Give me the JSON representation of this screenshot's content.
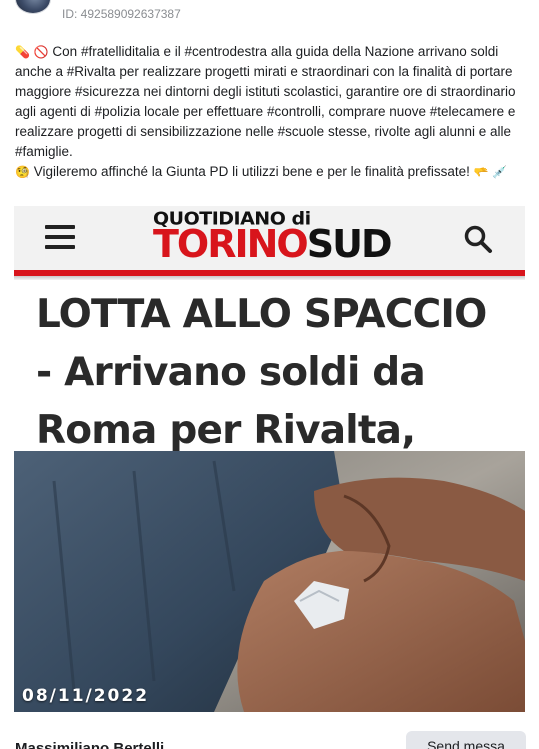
{
  "post": {
    "id_text": "ID: 492589092637387",
    "body": {
      "line1": [
        {
          "t": "💊",
          "k": "emoji-pill"
        },
        {
          "t": " "
        },
        {
          "t": "🚫",
          "k": "emoji-ban"
        },
        {
          "t": " Con "
        },
        {
          "t": "#fratelliditalia",
          "k": "hash"
        },
        {
          "t": " e il "
        },
        {
          "t": "#centrodestra",
          "k": "hash"
        },
        {
          "t": " alla guida della Nazione arrivano soldi anche a "
        },
        {
          "t": "#Rivalta",
          "k": "hash"
        },
        {
          "t": " per realizzare progetti mirati e straordinari con la finalità di portare maggiore "
        },
        {
          "t": "#sicurezza",
          "k": "hash"
        },
        {
          "t": " nei dintorni degli istituti scolastici, garantire ore di straordinario agli agenti di "
        },
        {
          "t": "#polizia",
          "k": "hash"
        },
        {
          "t": " locale per effettuare "
        },
        {
          "t": "#controlli",
          "k": "hash"
        },
        {
          "t": ", comprare nuove "
        },
        {
          "t": "#telecamere",
          "k": "hash"
        },
        {
          "t": " e realizzare progetti di sensibilizzazione nelle "
        },
        {
          "t": "#scuole",
          "k": "hash"
        },
        {
          "t": " stesse, rivolte agli alunni e alle "
        },
        {
          "t": "#famiglie",
          "k": "hash"
        },
        {
          "t": "."
        }
      ],
      "line2": [
        {
          "t": "🧐",
          "k": "emoji-face"
        },
        {
          "t": " Vigileremo affinché la Giunta PD li utilizzi bene e per le finalità prefissate! "
        },
        {
          "t": "🫳",
          "k": "emoji-hand"
        },
        {
          "t": " "
        },
        {
          "t": "💉",
          "k": "emoji-syringe"
        }
      ]
    }
  },
  "card": {
    "logo_top": "QUOTIDIANO di",
    "logo_torino": "TORINO",
    "logo_sud": "SUD",
    "headline_l1": "LOTTA ALLO SPACCIO",
    "headline_l2": "- Arrivano soldi da",
    "headline_l3": "Roma per Rivalta,",
    "date": "08/11/2022",
    "icons": {
      "menu": "hamburger-menu-icon",
      "search": "search-icon"
    },
    "colors": {
      "brand_red": "#d8151c",
      "headline": "#2a2a2a"
    }
  },
  "footer": {
    "name": "Massimiliano Bertelli",
    "send_label": "Send messa"
  }
}
